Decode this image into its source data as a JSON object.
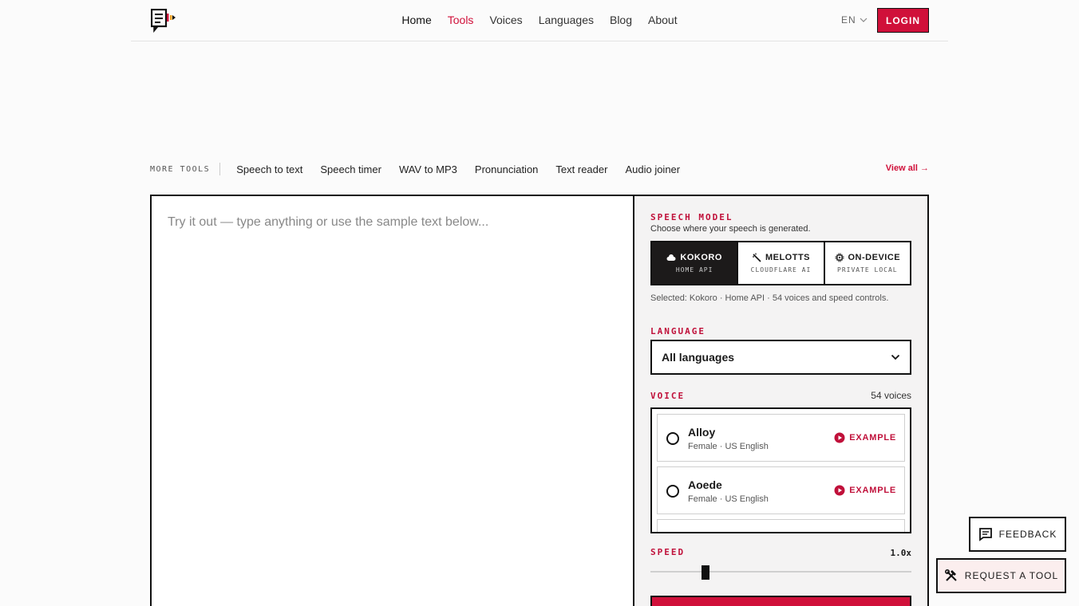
{
  "header": {
    "nav": [
      "Home",
      "Tools",
      "Voices",
      "Languages",
      "Blog",
      "About"
    ],
    "lang": "EN",
    "login_label": "LOGIN"
  },
  "more_tools": {
    "label": "MORE TOOLS",
    "links": [
      "Speech to text",
      "Speech timer",
      "WAV to MP3",
      "Pronunciation",
      "Text reader",
      "Audio joiner"
    ],
    "view_all": "View all →"
  },
  "editor": {
    "placeholder": "Try it out — type anything or use the sample text below..."
  },
  "speech_model": {
    "label": "SPEECH MODEL",
    "subtitle": "Choose where your speech is generated.",
    "options": [
      {
        "name": "KOKORO",
        "tag": "HOME API",
        "icon": "cloud-icon"
      },
      {
        "name": "MELOTTS",
        "tag": "CLOUDFLARE AI",
        "icon": "magic-wand-icon"
      },
      {
        "name": "ON-DEVICE",
        "tag": "PRIVATE LOCAL",
        "icon": "chip-icon"
      }
    ],
    "selected_note": "Selected: Kokoro · Home API · 54 voices and speed controls."
  },
  "language": {
    "label": "LANGUAGE",
    "value": "All languages"
  },
  "voice": {
    "label": "VOICE",
    "count": "54 voices",
    "items": [
      {
        "name": "Alloy",
        "meta": "Female · US English",
        "example": "EXAMPLE"
      },
      {
        "name": "Aoede",
        "meta": "Female · US English",
        "example": "EXAMPLE"
      }
    ]
  },
  "speed": {
    "label": "SPEED",
    "value": "1.0x"
  },
  "floating": {
    "feedback": "FEEDBACK",
    "request": "REQUEST A TOOL"
  },
  "colors": {
    "accent": "#d0103a",
    "dark": "#1c1a1a"
  }
}
